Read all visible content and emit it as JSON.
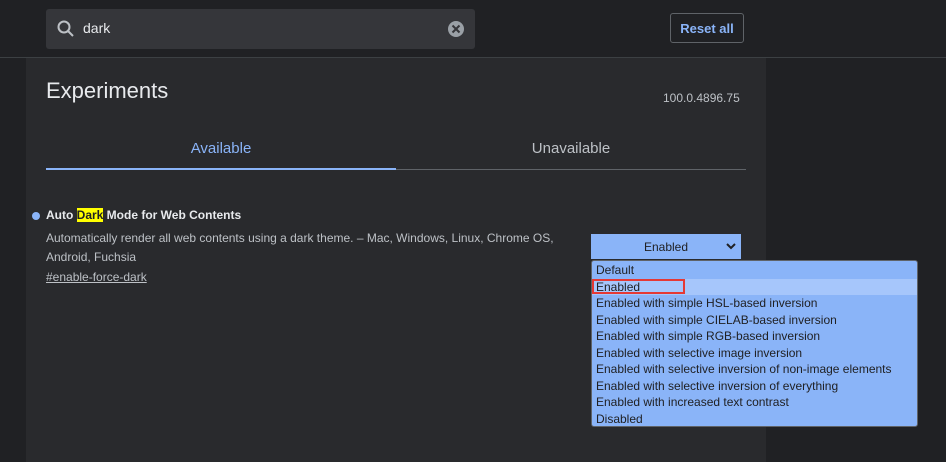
{
  "header": {
    "search_value": "dark",
    "reset_label": "Reset all"
  },
  "page": {
    "title": "Experiments",
    "version": "100.0.4896.75",
    "tabs": [
      {
        "label": "Available"
      },
      {
        "label": "Unavailable"
      }
    ]
  },
  "experiment": {
    "title_prefix": "Auto ",
    "title_highlight": "Dark",
    "title_suffix": " Mode for Web Contents",
    "description": "Automatically render all web contents using a dark theme. – Mac, Windows, Linux, Chrome OS, Android, Fuchsia",
    "link": "#enable-force-dark",
    "select_value": "Enabled",
    "options": [
      {
        "label": "Default"
      },
      {
        "label": "Enabled"
      },
      {
        "label": "Enabled with simple HSL-based inversion"
      },
      {
        "label": "Enabled with simple CIELAB-based inversion"
      },
      {
        "label": "Enabled with simple RGB-based inversion"
      },
      {
        "label": "Enabled with selective image inversion"
      },
      {
        "label": "Enabled with selective inversion of non-image elements"
      },
      {
        "label": "Enabled with selective inversion of everything"
      },
      {
        "label": "Enabled with increased text contrast"
      },
      {
        "label": "Disabled"
      }
    ],
    "selected_index": 1
  },
  "colors": {
    "accent": "#8ab4f8",
    "background": "#202124",
    "panel": "#292a2d",
    "highlight": "#ffff00",
    "selection_outline": "#e53935"
  }
}
